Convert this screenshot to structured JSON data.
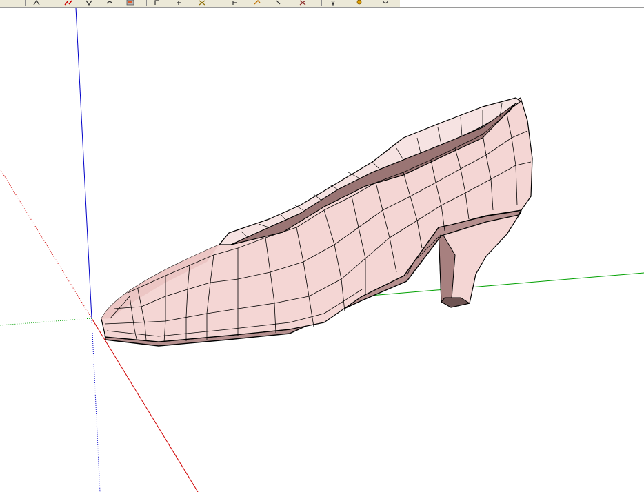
{
  "app": {
    "colors": {
      "toolbar_bg": "#ece9d8",
      "axis_red": "#d00000",
      "axis_green": "#00a000",
      "axis_blue": "#0000c8",
      "model_fill": "#f4d6d4",
      "model_shadow": "#c9a3a2",
      "model_edge": "#000000"
    }
  },
  "toolbar": {
    "buttons": [
      {
        "icon": "rotate-icon"
      },
      {
        "icon": "follow-me-icon"
      },
      {
        "icon": "scale-icon"
      },
      {
        "icon": "offset-icon"
      },
      {
        "icon": "paint-bucket-icon"
      },
      {
        "icon": "orbit-icon"
      },
      {
        "icon": "pan-icon"
      },
      {
        "icon": "zoom-icon"
      },
      {
        "icon": "zoom-window-icon"
      },
      {
        "icon": "previous-view-icon"
      },
      {
        "icon": "next-view-icon"
      },
      {
        "icon": "zoom-extents-icon"
      },
      {
        "icon": "position-camera-icon"
      },
      {
        "icon": "look-around-icon"
      },
      {
        "icon": "walk-icon"
      }
    ]
  }
}
